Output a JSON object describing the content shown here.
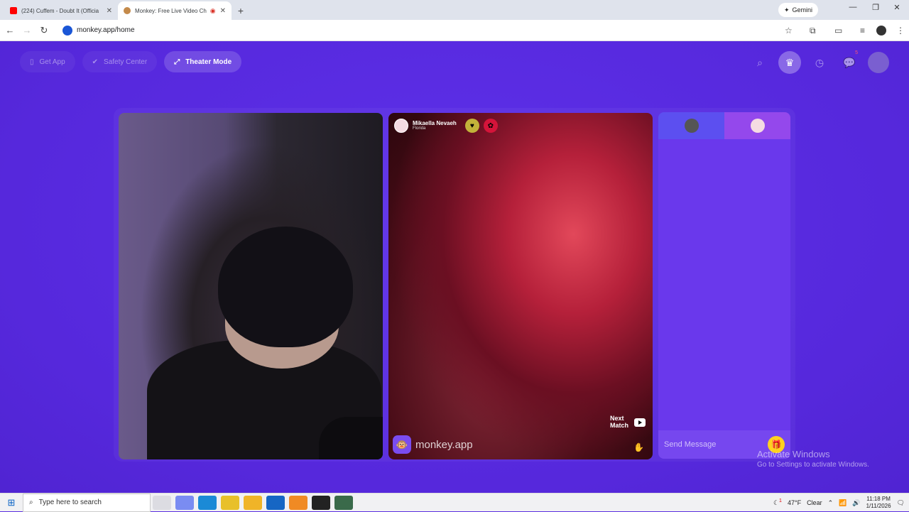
{
  "browser": {
    "tabs": [
      {
        "title": "(224) Cuffem - Doubt It (Officia",
        "favicon": "youtube-icon",
        "color": "#ff0000"
      },
      {
        "title": "Monkey: Free Live Video Ch",
        "favicon": "monkey-icon",
        "color": "#8b5a2b",
        "active": true
      }
    ],
    "new_tab": "+",
    "gemini_label": "Gemini",
    "url": "monkey.app/home"
  },
  "nav": {
    "get_app": "Get App",
    "safety_center": "Safety Center",
    "theater_mode": "Theater Mode",
    "messages_badge": "5"
  },
  "peer": {
    "name": "Mikaella Nevaeh",
    "location": "Florida"
  },
  "brand": "monkey.app",
  "next_match": {
    "line1": "Next",
    "line2": "Match"
  },
  "chat": {
    "placeholder": "Send Message"
  },
  "activate": {
    "title": "Activate Windows",
    "subtitle": "Go to Settings to activate Windows."
  },
  "taskbar": {
    "search_placeholder": "Type here to search",
    "weather_temp": "47°F",
    "weather_desc": "Clear",
    "weather_badge": "1",
    "time": "11:18 PM",
    "date": "1/11/2026"
  },
  "colors": {
    "page_bg": "#5a2ee0",
    "chat_bg": "#6a38ec",
    "gift": "#ffd21f"
  }
}
